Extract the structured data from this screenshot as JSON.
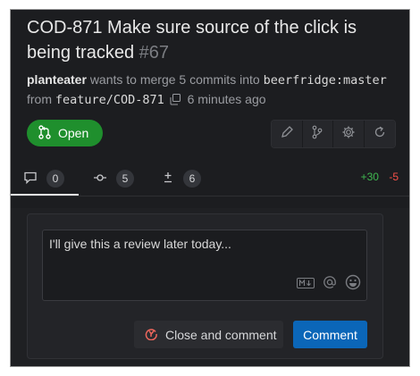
{
  "pr": {
    "title": "COD-871 Make sure source of the click is being tracked",
    "number": "#67",
    "author": "planteater",
    "merge_text": "wants to merge 5 commits into",
    "target_branch": "beerfridge:master",
    "from_label": "from",
    "source_branch": "feature/COD-871",
    "time_ago": "6 minutes ago",
    "status": "Open"
  },
  "actions": [
    {
      "icon": "pencil-icon"
    },
    {
      "icon": "branch-icon"
    },
    {
      "icon": "gear-icon"
    },
    {
      "icon": "refresh-icon"
    }
  ],
  "tabs": [
    {
      "icon": "comment-icon",
      "count": "0"
    },
    {
      "icon": "commit-icon",
      "count": "5"
    },
    {
      "icon": "plus-minus-icon",
      "count": "6"
    }
  ],
  "diff": {
    "additions": "+30",
    "deletions": "-5"
  },
  "composer": {
    "text": "I'll give this a review later today...",
    "close_label": "Close and comment",
    "comment_label": "Comment"
  },
  "colors": {
    "accent": "#0b66b8",
    "open": "#1f8f2d",
    "add": "#3fb950",
    "del": "#f85149"
  }
}
